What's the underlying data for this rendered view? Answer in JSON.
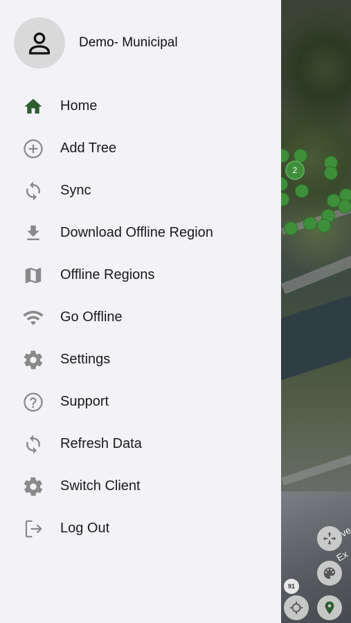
{
  "profile": {
    "name": "Demo- Municipal",
    "icon": "person-icon"
  },
  "menu": [
    {
      "label": "Home",
      "icon": "home-icon",
      "color": "#2e5e2e"
    },
    {
      "label": "Add Tree",
      "icon": "add-circle-icon",
      "color": "#8a8a8a"
    },
    {
      "label": "Sync",
      "icon": "sync-icon",
      "color": "#8a8a8a"
    },
    {
      "label": "Download Offline Region",
      "icon": "download-icon",
      "color": "#8a8a8a"
    },
    {
      "label": "Offline Regions",
      "icon": "map-icon",
      "color": "#8a8a8a"
    },
    {
      "label": "Go Offline",
      "icon": "wifi-icon",
      "color": "#8a8a8a"
    },
    {
      "label": "Settings",
      "icon": "gear-icon",
      "color": "#8a8a8a"
    },
    {
      "label": "Support",
      "icon": "help-circle-icon",
      "color": "#8a8a8a"
    },
    {
      "label": "Refresh Data",
      "icon": "refresh-icon",
      "color": "#8a8a8a"
    },
    {
      "label": "Switch Client",
      "icon": "gear-icon",
      "color": "#8a8a8a"
    },
    {
      "label": "Log Out",
      "icon": "logout-icon",
      "color": "#8a8a8a"
    }
  ],
  "map": {
    "cluster_count": "2",
    "route_badge": "91",
    "street_label_1": "ve",
    "street_label_2": "Ex",
    "tree_color": "#3f8f3a"
  }
}
